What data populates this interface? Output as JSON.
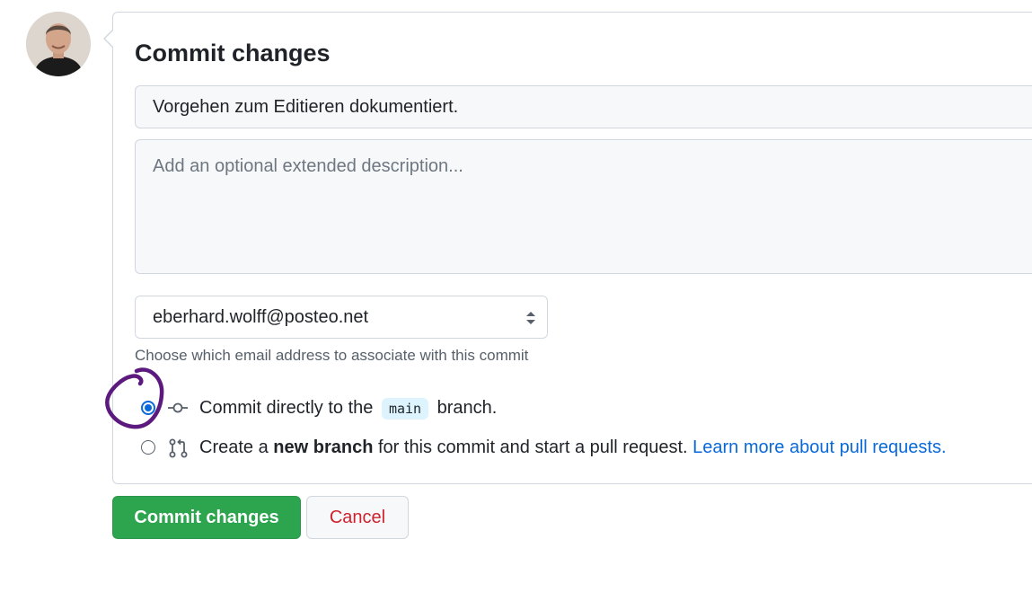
{
  "commit_form": {
    "title": "Commit changes",
    "summary_value": "Vorgehen zum Editieren dokumentiert.",
    "description_placeholder": "Add an optional extended description...",
    "email_selected": "eberhard.wolff@posteo.net",
    "email_hint": "Choose which email address to associate with this commit",
    "options": {
      "direct": {
        "prefix": "Commit directly to the",
        "branch": "main",
        "suffix": "branch.",
        "icon": "git-commit-icon",
        "checked": true
      },
      "new_branch": {
        "prefix": "Create a",
        "bold": "new branch",
        "middle": "for this commit and start a pull request.",
        "link": "Learn more about pull requests.",
        "icon": "git-pull-request-icon",
        "checked": false
      }
    },
    "buttons": {
      "commit": "Commit changes",
      "cancel": "Cancel"
    }
  },
  "colors": {
    "primary": "#2da44e",
    "cancel_text": "#cf222e",
    "link": "#0969da",
    "annotation": "#5c1a7e"
  }
}
